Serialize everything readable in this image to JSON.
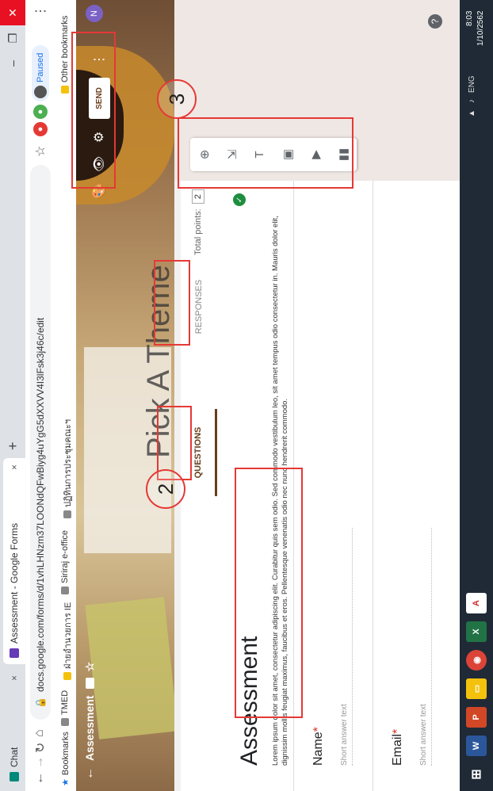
{
  "browser": {
    "tabs": [
      {
        "label": "Chat"
      },
      {
        "label": "Assessment - Google Forms"
      }
    ],
    "new_tab": "+",
    "url": "docs.google.com/forms/d/1vhLHNzm37LOONdQFwBiyg4uYgG5dXXVV4I3lFsk3j46c/edit",
    "profile_label": "Paused",
    "bookmarks": [
      "Bookmarks",
      "TMED",
      "ฝ่ายอำนวยการ IE",
      "Siriraj e-office",
      "ปฏิทินการประชุมคณะฯ"
    ],
    "other_bookmarks": "Other bookmarks"
  },
  "form_header": {
    "title": "Assessment",
    "send_label": "SEND",
    "avatar_initial": "N",
    "theme_text": "Pick A Theme"
  },
  "tabs": {
    "questions": "QUESTIONS",
    "responses": "RESPONSES",
    "total_points_label": "Total points:",
    "total_points_value": "2"
  },
  "form": {
    "title": "Assessment",
    "description": "Lorem ipsum dolor sit amet, consectetur adipiscing elit. Curabitur quis sem odio. Sed commodo vestibulum leo, sit amet tempus odio consectetur in. Mauris dolor elit, dignissim mollis feugiat maximus, faucibus et eros. Pellentesque venenatis odio nec nunc hendrerit commodo.",
    "questions": [
      {
        "label": "Name",
        "placeholder": "Short answer text"
      },
      {
        "label": "Email",
        "placeholder": "Short answer text"
      }
    ]
  },
  "annotations": {
    "two": "2",
    "three": "3"
  },
  "taskbar": {
    "time": "8:03",
    "date": "1/10/2562",
    "lang": "ENG"
  }
}
